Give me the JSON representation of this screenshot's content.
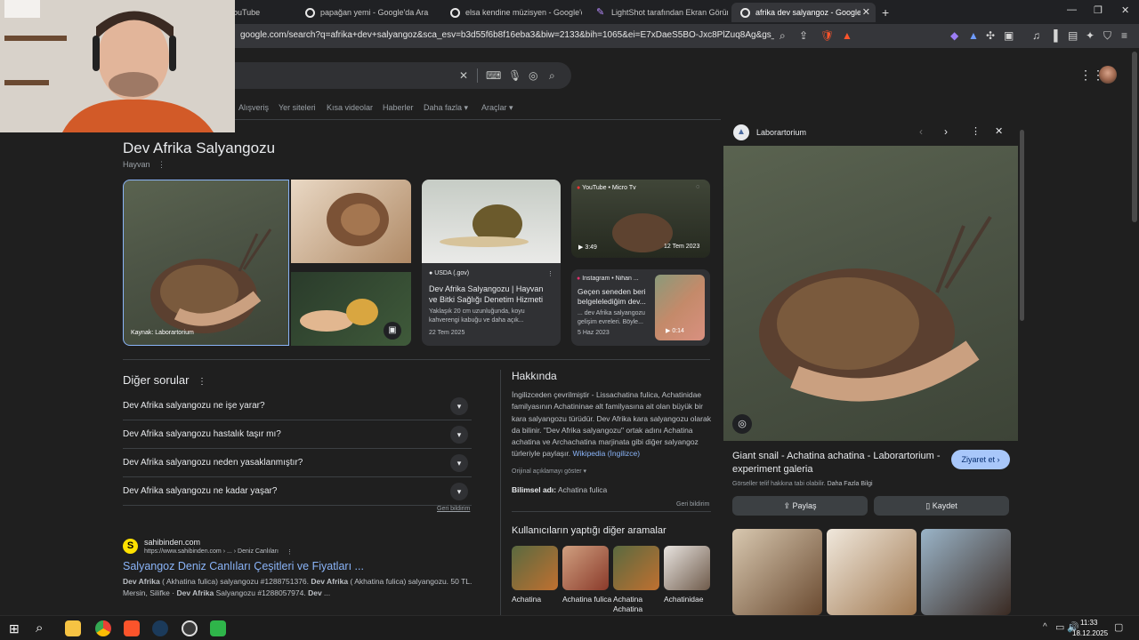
{
  "browser": {
    "tabs": [
      {
        "label": "ouTube",
        "active": false
      },
      {
        "label": "papağan yemi - Google'da Ara",
        "active": false
      },
      {
        "label": "elsa kendine müzisyen - Google'da A",
        "active": false
      },
      {
        "label": "LightShot tarafından Ekran Görüntüs",
        "active": false
      },
      {
        "label": "afrika dev salyangoz - Google'da",
        "active": true
      }
    ],
    "new_tab": "+",
    "url": "google.com/search?q=afrika+dev+salyangoz&sca_esv=b3d55f6b8f16eba3&biw=2133&bih=1065&ei=E7xDaeS5BO-Jxc8PlZuq8Ag&gs_ssp=eJ...",
    "ext_badge_1": "4",
    "ext_badge_2": "1"
  },
  "search": {
    "nav_tabs": [
      "Alışveriş",
      "Yer siteleri",
      "Kısa videolar",
      "Haberler",
      "Daha fazla",
      "Araçlar"
    ]
  },
  "entity": {
    "title": "Dev Afrika Salyangozu",
    "subtitle": "Hayvan",
    "main_image_caption": "Kaynak: Laborartorium",
    "usda_source": "USDA (.gov)",
    "usda_title": "Dev Afrika Salyangozu | Hayvan ve Bitki Sağlığı Denetim Hizmeti",
    "usda_snippet": "Yaklaşık 20 cm uzunluğunda, koyu kahverengi kabuğu ve daha açık...",
    "usda_date": "22 Tem 2025",
    "yt_source": "YouTube • Micro Tv",
    "yt_duration": "3:49",
    "yt_date": "12 Tem 2023",
    "ig_source": "Instagram • Nihan ...",
    "ig_title": "Geçen seneden beri belgelelediğim dev...",
    "ig_snippet": "... dev Afrika salyangozu gelişim evreleri. Böyle...",
    "ig_date": "5 Haz 2023",
    "ig_duration": "0:14"
  },
  "questions": {
    "title": "Diğer sorular",
    "items": [
      "Dev Afrika salyangozu ne işe yarar?",
      "Dev Afrika salyangozu hastalık taşır mı?",
      "Dev Afrika salyangozu neden yasaklanmıştır?",
      "Dev Afrika salyangozu ne kadar yaşar?"
    ],
    "feedback": "Geri bildirim"
  },
  "about": {
    "title": "Hakkında",
    "text": "İngilizceden çevrilmiştir - Lissachatina fulica, Achatinidae familyasının Achatininae alt familyasına ait olan büyük bir kara salyangozu türüdür. Dev Afrika kara salyangozu olarak da bilinir. \"Dev Afrika salyangozu\" ortak adını Achatina achatina ve Archachatina marjinata gibi diğer salyangoz türleriyle paylaşır.",
    "wiki_link": "Wikipedia (İngilizce)",
    "show_original": "Orijinal açıklamayı göster",
    "sci_label": "Bilimsel adı:",
    "sci_value": "Achatina fulica",
    "feedback": "Geri bildirim"
  },
  "related": {
    "title": "Kullanıcıların yaptığı diğer aramalar",
    "items": [
      "Achatina",
      "Achatina fulica",
      "Achatina Achatina",
      "Achatinidae"
    ]
  },
  "result": {
    "site": "sahibinden.com",
    "url": "https://www.sahibinden.com › ... › Deniz Canlıları",
    "title": "Salyangoz Deniz Canlıları Çeşitleri ve Fiyatları ...",
    "snippet_1_b1": "Dev Afrika",
    "snippet_1_t1": " ( Akhatina fulica) salyangozu #1288751376. ",
    "snippet_1_b2": "Dev Afrika",
    "snippet_1_t2": " ( Akhatina fulica) salyangozu. 50 TL.",
    "snippet_2_t1": "Mersin, Silifke · ",
    "snippet_2_b1": "Dev Afrika",
    "snippet_2_t2": " Salyangozu #1288057974. ",
    "snippet_2_b2": "Dev",
    "snippet_2_t3": " ..."
  },
  "panel": {
    "source": "Laborartorium",
    "caption": "Giant snail - Achatina achatina - Laborartorium - experiment galeria",
    "visit": "Ziyaret et",
    "copyright": "Görseller telif hakkına tabi olabilir.",
    "more_info": "Daha Fazla Bilgi",
    "share": "Paylaş",
    "save": "Kaydet"
  },
  "taskbar": {
    "time": "11:33",
    "date": "18.12.2025"
  },
  "colors": {
    "link": "#8ab4f8",
    "bg": "#1f1f1f",
    "card": "#303134",
    "accent_button": "#a8c7fa"
  }
}
